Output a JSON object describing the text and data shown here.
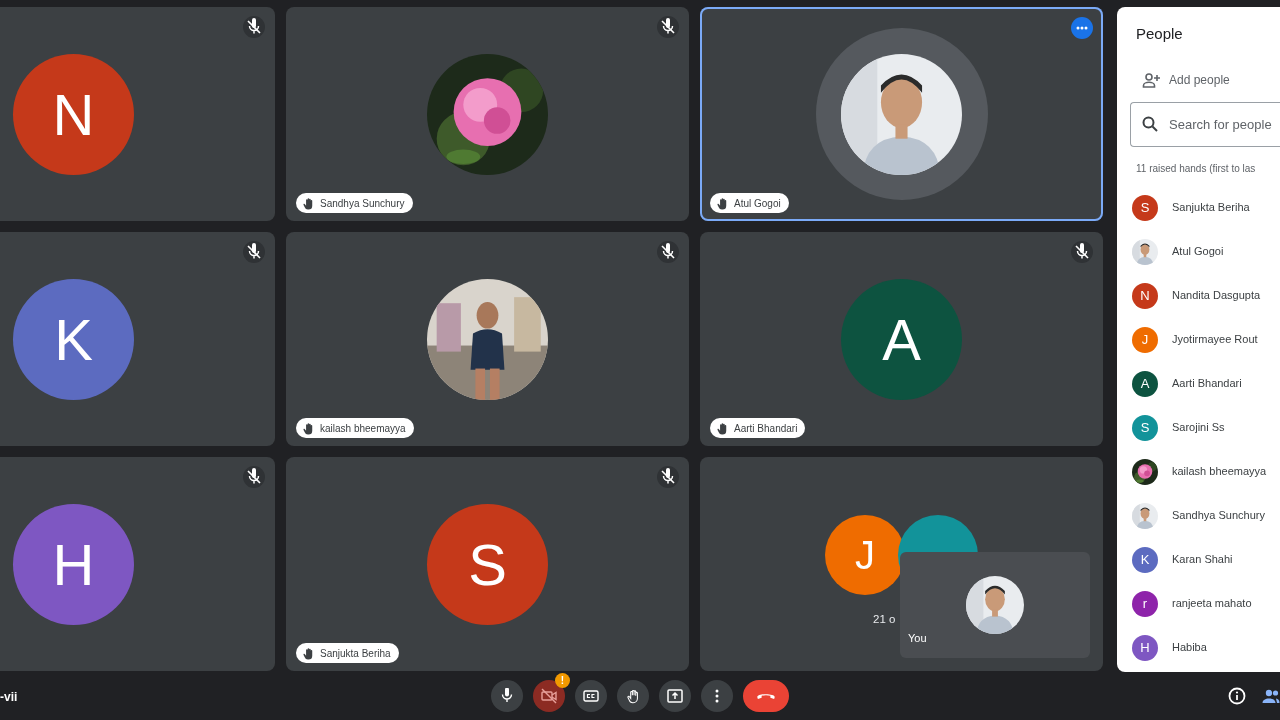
{
  "tiles": [
    {
      "kind": "letter",
      "letter": "N",
      "color": "#c5391a",
      "muted": true
    },
    {
      "kind": "picture",
      "name": "Sandhya Sunchury",
      "hand_raised": true,
      "muted": true
    },
    {
      "kind": "picture",
      "name": "Atul Gogoi",
      "hand_raised": true,
      "muted": false,
      "highlighted": true,
      "speaking": true,
      "more": true
    },
    {
      "kind": "letter",
      "letter": "K",
      "color": "#5c6bc0",
      "muted": true
    },
    {
      "kind": "picture",
      "name": "kailash bheemayya",
      "hand_raised": true,
      "muted": true
    },
    {
      "kind": "letter",
      "letter": "A",
      "color": "#0d5340",
      "name": "Aarti Bhandari",
      "hand_raised": true,
      "muted": true
    },
    {
      "kind": "letter",
      "letter": "H",
      "color": "#7e57c2",
      "muted": true
    },
    {
      "kind": "letter",
      "letter": "S",
      "color": "#c5391a",
      "name": "Sanjukta Beriha",
      "hand_raised": true,
      "muted": true
    },
    {
      "kind": "group",
      "avatars": [
        {
          "letter": "J",
          "color": "#ef6c00"
        },
        {
          "color": "#12939a"
        }
      ],
      "count": "21 o",
      "self_view": {
        "label": "You"
      }
    }
  ],
  "meeting_code": "-vii",
  "controls": [
    {
      "kind": "mic",
      "off": false
    },
    {
      "kind": "camera",
      "off": true,
      "alert": "!"
    },
    {
      "kind": "captions",
      "off": false
    },
    {
      "kind": "hand",
      "off": false
    },
    {
      "kind": "present",
      "off": false
    },
    {
      "kind": "more",
      "off": false
    },
    {
      "kind": "end",
      "off": false
    }
  ],
  "people_panel": {
    "title": "People",
    "add_label": "Add people",
    "search": {
      "placeholder": "Search for people"
    },
    "section": "11 raised hands (first to las",
    "items": [
      {
        "kind": "letter",
        "letter": "S",
        "color": "#c5391a",
        "name": "Sanjukta Beriha"
      },
      {
        "kind": "picture",
        "name": "Atul Gogoi"
      },
      {
        "kind": "letter",
        "letter": "N",
        "color": "#c5391a",
        "name": "Nandita Dasgupta"
      },
      {
        "kind": "letter",
        "letter": "J",
        "color": "#ef6c00",
        "name": "Jyotirmayee Rout"
      },
      {
        "kind": "letter",
        "letter": "A",
        "color": "#0d5340",
        "name": "Aarti Bhandari"
      },
      {
        "kind": "letter",
        "letter": "S",
        "color": "#12939a",
        "name": "Sarojini Ss"
      },
      {
        "kind": "picture",
        "name": "kailash bheemayya"
      },
      {
        "kind": "picture",
        "name": "Sandhya Sunchury"
      },
      {
        "kind": "letter",
        "letter": "K",
        "color": "#5c6bc0",
        "name": "Karan Shahi"
      },
      {
        "kind": "letter",
        "letter": "r",
        "color": "#8e24aa",
        "name": "ranjeeta mahato"
      },
      {
        "kind": "letter",
        "letter": "H",
        "color": "#7e57c2",
        "name": "Habiba"
      }
    ]
  }
}
